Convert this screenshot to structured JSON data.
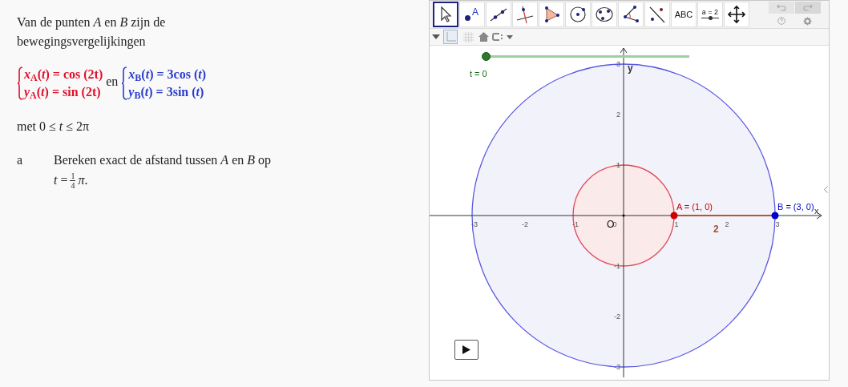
{
  "exercise": {
    "intro": "Van de punten *A* en *B* zijn de bewegingsvergelijkingen",
    "systems": [
      {
        "color": "#e0102a",
        "lines": [
          "*x*$_{A}$(*t*) = cos (2t)",
          "*y*$_{A}$(*t*) = sin (2t)"
        ]
      },
      {
        "color": "#2a3ccc",
        "lines": [
          "*x*$_{B}$(*t*) = 3cos (*t*)",
          "*y*$_{B}$(*t*) = 3sin (*t*)"
        ]
      }
    ],
    "conjunction": "en",
    "condition": "met 0 ≤ *t* ≤ 2π",
    "question": {
      "label": "a",
      "text": "Bereken exact de afstand tussen *A* en *B* op",
      "lhs": "*t* =",
      "numerator": "1",
      "denominator": "4",
      "rhs": "*π*."
    }
  },
  "applet": {
    "tools": [
      {
        "kind": "move",
        "selected": true
      },
      {
        "kind": "point",
        "label": "A",
        "selected": false
      },
      {
        "kind": "line",
        "selected": false
      },
      {
        "kind": "perpendicular",
        "selected": false
      },
      {
        "kind": "polygon",
        "selected": false
      },
      {
        "kind": "circle",
        "selected": false
      },
      {
        "kind": "conic",
        "selected": false
      },
      {
        "kind": "angle",
        "selected": false
      },
      {
        "kind": "reflect",
        "selected": false
      },
      {
        "kind": "text",
        "label": "ABC",
        "selected": false
      },
      {
        "kind": "slider",
        "label": "a = 2",
        "selected": false
      },
      {
        "kind": "move-view",
        "selected": false
      }
    ],
    "style_bar": {
      "axes_on": true,
      "grid_on": false
    },
    "slider": {
      "level": 0,
      "label": "t = 0"
    },
    "graph": {
      "x_axis_label": "x",
      "y_axis_label": "y",
      "origin_label": "O",
      "x_ticks": [
        "-3",
        "-2",
        "-1",
        "0",
        "1",
        "2",
        "3"
      ],
      "y_ticks": [
        "3",
        "2",
        "1",
        "-1",
        "-2",
        "-3"
      ],
      "points": [
        {
          "label": "A = (1, 0)",
          "color": "#cc0000"
        },
        {
          "label": "B = (3, 0)",
          "color": "#0000cc"
        }
      ],
      "segment_label": "2"
    }
  }
}
